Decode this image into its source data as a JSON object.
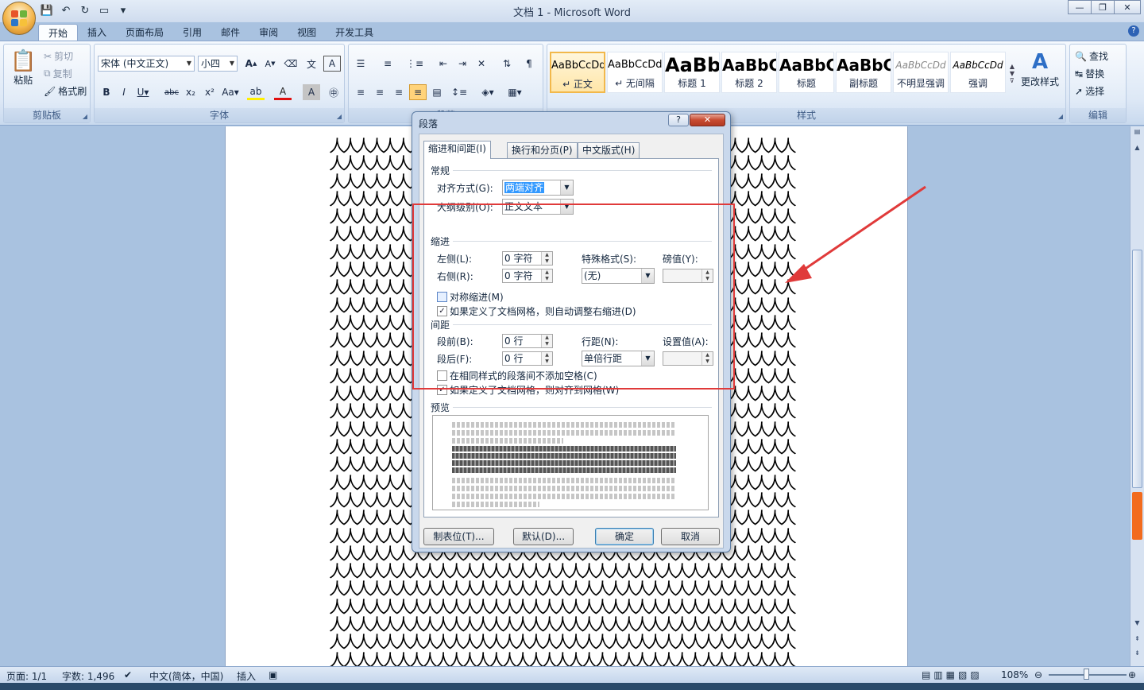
{
  "window": {
    "title": "文档 1 - Microsoft Word",
    "min": "—",
    "max": "❐",
    "close": "✕"
  },
  "ribbon_tabs": [
    "开始",
    "插入",
    "页面布局",
    "引用",
    "邮件",
    "审阅",
    "视图",
    "开发工具"
  ],
  "clipboard": {
    "paste": "粘贴",
    "cut": "剪切",
    "copy": "复制",
    "format_painter": "格式刷",
    "label": "剪贴板"
  },
  "font": {
    "name": "宋体 (中文正文)",
    "size": "小四",
    "label": "字体"
  },
  "paragraph": {
    "label": "段落"
  },
  "styles": {
    "label": "样式",
    "items": [
      {
        "sample": "AaBbCcDd",
        "name": "↵ 正文"
      },
      {
        "sample": "AaBbCcDd",
        "name": "↵ 无间隔"
      },
      {
        "sample": "AaBb",
        "name": "标题 1"
      },
      {
        "sample": "AaBbC",
        "name": "标题 2"
      },
      {
        "sample": "AaBbC",
        "name": "标题"
      },
      {
        "sample": "AaBbC",
        "name": "副标题"
      },
      {
        "sample": "AaBbCcDd",
        "name": "不明显强调"
      },
      {
        "sample": "AaBbCcDd",
        "name": "强调"
      }
    ],
    "change": "更改样式"
  },
  "editing": {
    "label": "编辑",
    "find": "查找",
    "replace": "替换",
    "select": "选择"
  },
  "document": {
    "char": "人"
  },
  "dialog": {
    "title": "段落",
    "help": "?",
    "close": "✕",
    "tabs": [
      "缩进和间距(I)",
      "换行和分页(P)",
      "中文版式(H)"
    ],
    "general": {
      "heading": "常规",
      "align_label": "对齐方式(G):",
      "align_value": "两端对齐",
      "outline_label": "大纲级别(O):",
      "outline_value": "正文文本"
    },
    "indent": {
      "heading": "缩进",
      "left_label": "左侧(L):",
      "left_value": "0 字符",
      "right_label": "右侧(R):",
      "right_value": "0 字符",
      "special_label": "特殊格式(S):",
      "special_value": "(无)",
      "by_label": "磅值(Y):",
      "by_value": "",
      "mirror": "对称缩进(M)",
      "auto_adjust": "如果定义了文档网格，则自动调整右缩进(D)"
    },
    "spacing": {
      "heading": "间距",
      "before_label": "段前(B):",
      "before_value": "0 行",
      "after_label": "段后(F):",
      "after_value": "0 行",
      "line_label": "行距(N):",
      "line_value": "单倍行距",
      "at_label": "设置值(A):",
      "at_value": "",
      "no_space": "在相同样式的段落间不添加空格(C)",
      "snap_grid": "如果定义了文档网格，则对齐到网格(W)"
    },
    "preview": {
      "heading": "预览"
    },
    "buttons": {
      "tabs": "制表位(T)...",
      "default": "默认(D)...",
      "ok": "确定",
      "cancel": "取消"
    }
  },
  "status": {
    "page": "页面: 1/1",
    "words": "字数: 1,496",
    "lang": "中文(简体，中国)",
    "insert": "插入",
    "zoom": "108%"
  },
  "colors": {
    "annotation": "#e03a3a",
    "highlight": "#3399ff"
  }
}
